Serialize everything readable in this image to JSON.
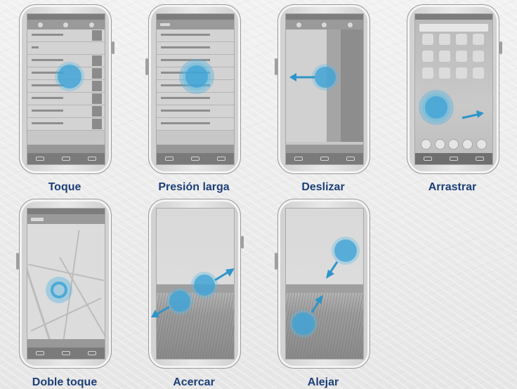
{
  "gestures": [
    {
      "label": "Toque"
    },
    {
      "label": "Presión larga"
    },
    {
      "label": "Deslizar"
    },
    {
      "label": "Arrastrar"
    },
    {
      "label": "Doble toque"
    },
    {
      "label": "Acercar"
    },
    {
      "label": "Alejar"
    }
  ],
  "colors": {
    "label": "#1d3f77",
    "touch": "#41a5d7",
    "arrow": "#2e95c9"
  }
}
